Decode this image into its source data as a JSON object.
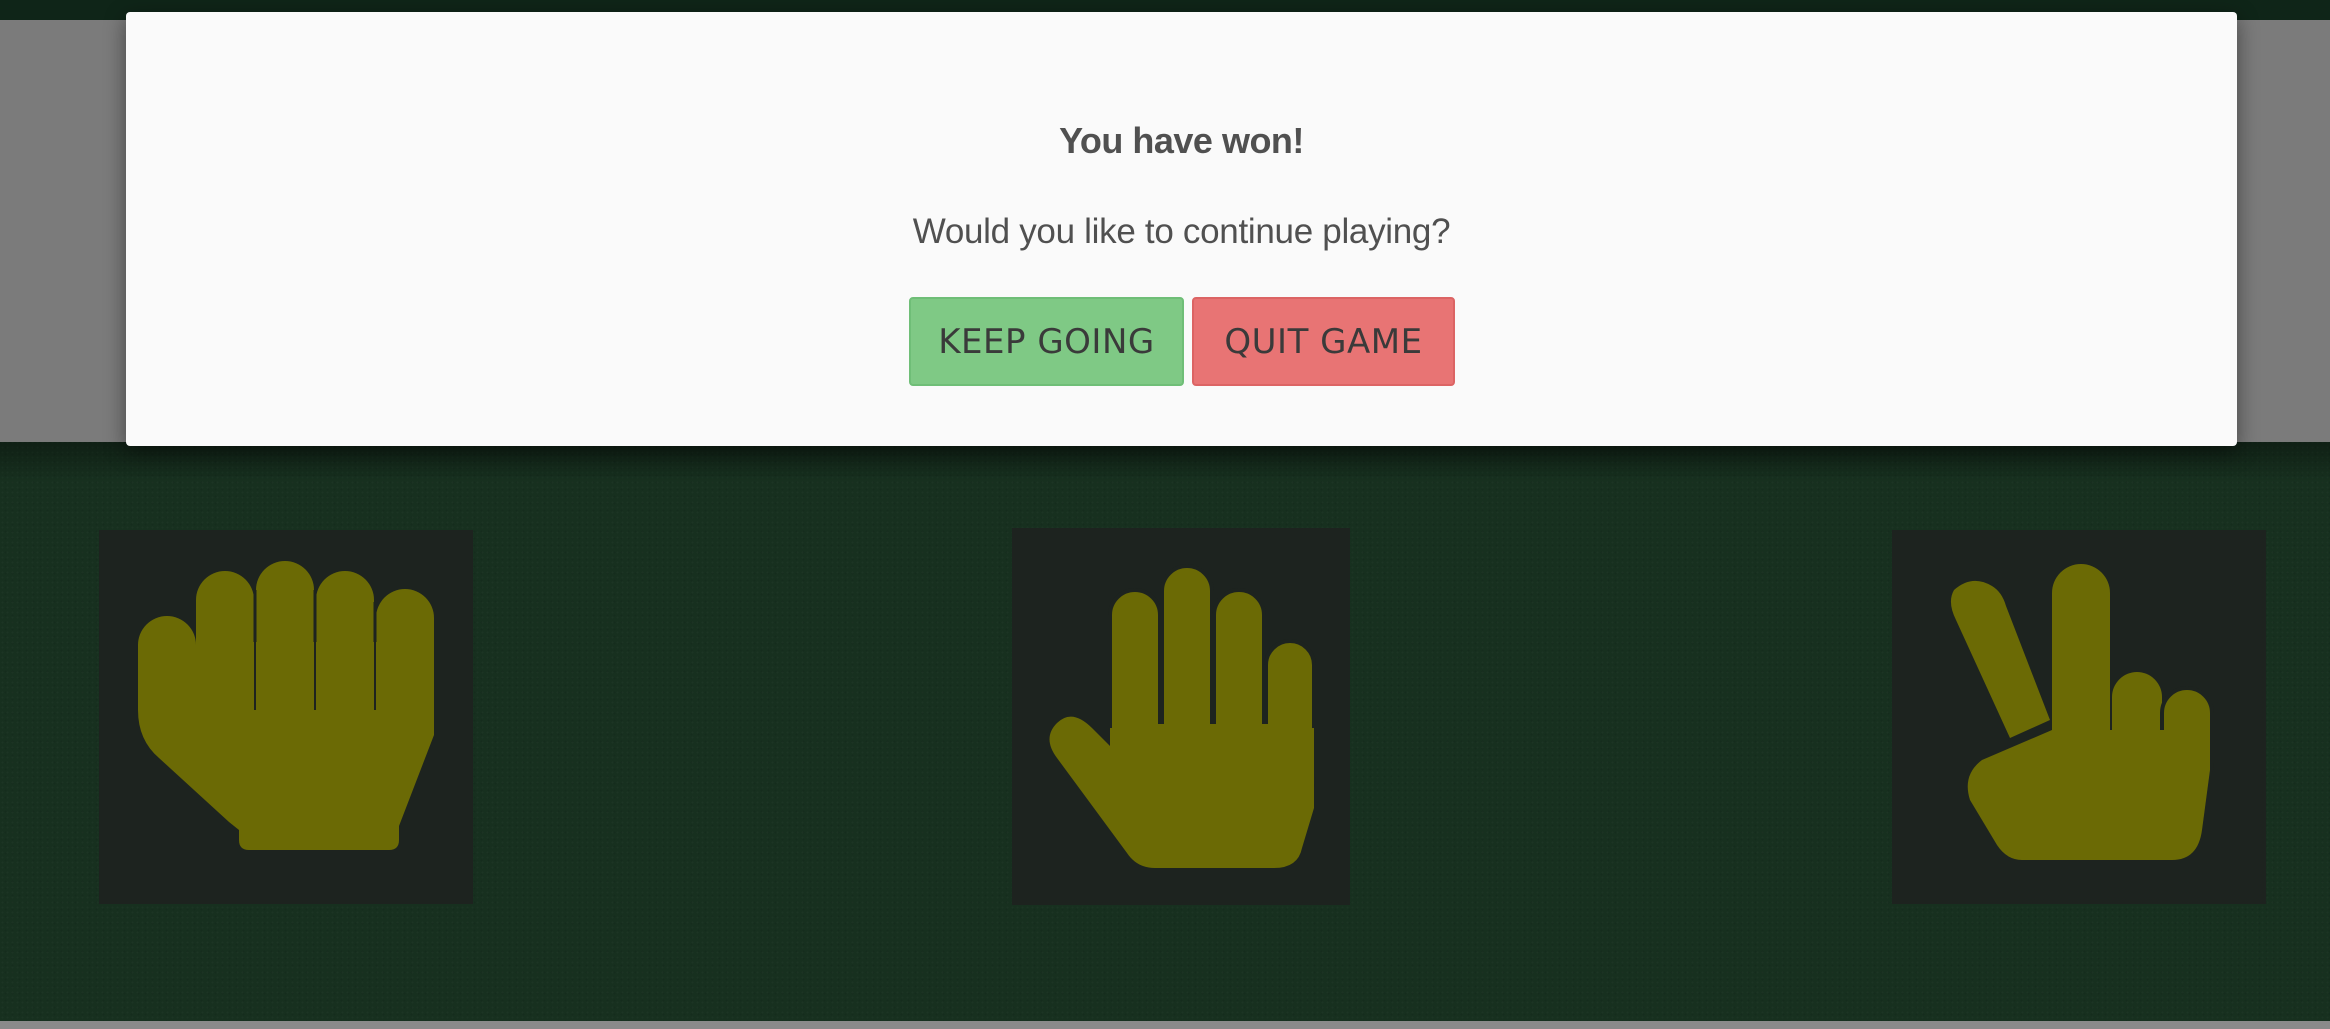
{
  "modal": {
    "title": "You have won!",
    "question": "Would you like to continue playing?",
    "keep_label": "KEEP GOING",
    "quit_label": "QUIT GAME"
  },
  "choices": [
    {
      "name": "rock",
      "icon": "rock-hand-icon"
    },
    {
      "name": "paper",
      "icon": "paper-hand-icon"
    },
    {
      "name": "scissors",
      "icon": "scissors-hand-icon"
    }
  ],
  "colors": {
    "table": "#17301f",
    "hand": "#6b6a05",
    "card": "#1d231f",
    "keep_button": "#7fc985",
    "quit_button": "#e87474"
  }
}
